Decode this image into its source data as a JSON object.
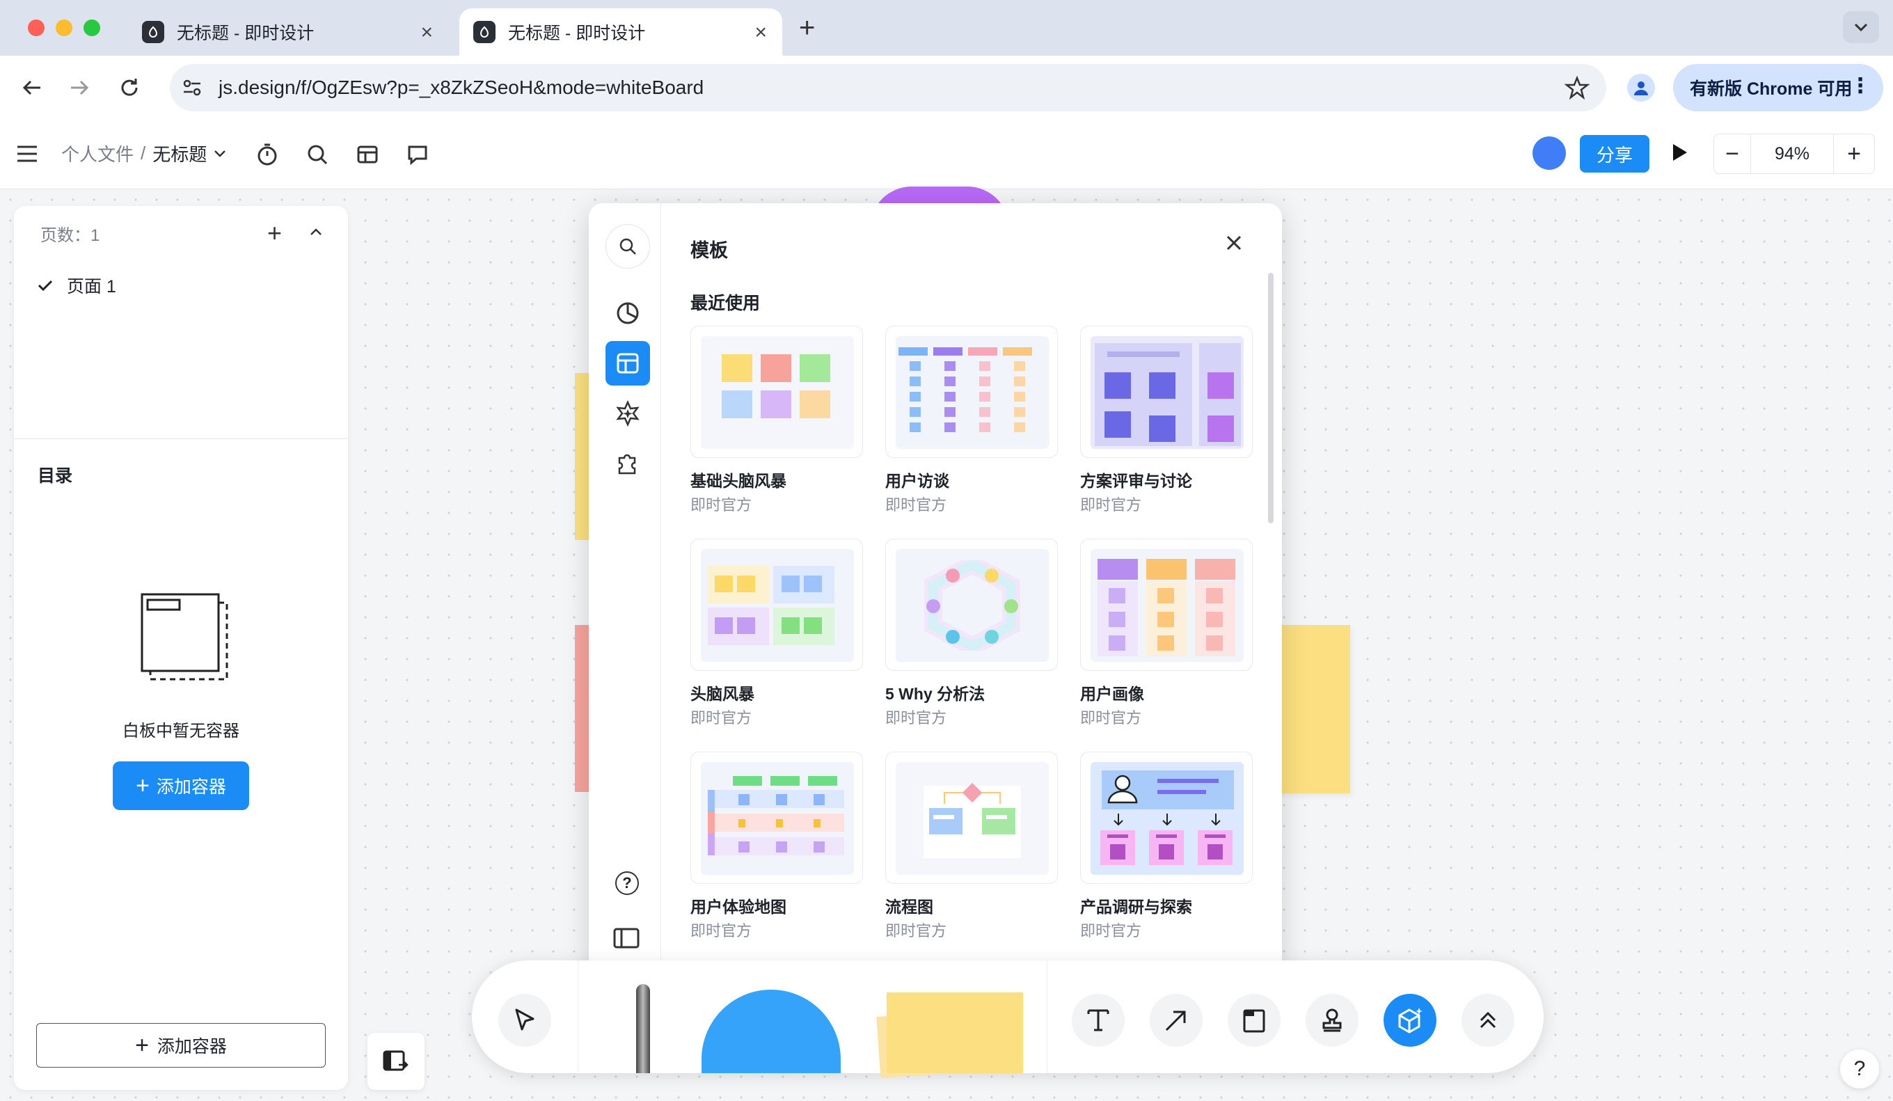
{
  "browser": {
    "tabs": [
      {
        "title": "无标题 - 即时设计",
        "active": false
      },
      {
        "title": "无标题 - 即时设计",
        "active": true
      }
    ],
    "url": "js.design/f/OgZEsw?p=_x8ZkZSeoH&mode=whiteBoard",
    "update_label": "有新版 Chrome 可用"
  },
  "header": {
    "breadcrumb_parent": "个人文件",
    "breadcrumb_sep": "/",
    "file_title": "无标题",
    "share_label": "分享",
    "zoom_value": "94%"
  },
  "left_panel": {
    "pages_label": "页数：1",
    "pages": [
      {
        "label": "页面 1",
        "selected": true
      }
    ],
    "toc_title": "目录",
    "empty_text": "白板中暂无容器",
    "add_container_primary": "添加容器",
    "add_container_secondary": "添加容器"
  },
  "templates": {
    "title": "模板",
    "section_title": "最近使用",
    "items": [
      {
        "name": "基础头脑风暴",
        "author": "即时官方"
      },
      {
        "name": "用户访谈",
        "author": "即时官方"
      },
      {
        "name": "方案评审与讨论",
        "author": "即时官方"
      },
      {
        "name": "头脑风暴",
        "author": "即时官方"
      },
      {
        "name": "5 Why 分析法",
        "author": "即时官方"
      },
      {
        "name": "用户画像",
        "author": "即时官方"
      },
      {
        "name": "用户体验地图",
        "author": "即时官方"
      },
      {
        "name": "流程图",
        "author": "即时官方"
      },
      {
        "name": "产品调研与探索",
        "author": "即时官方"
      }
    ]
  },
  "help_label": "?",
  "colors": {
    "accent": "#1b8bf6",
    "sticky_yellow": "#fcdf80",
    "sticky_red": "#f7a39c",
    "purple_shape": "#b86af7"
  }
}
